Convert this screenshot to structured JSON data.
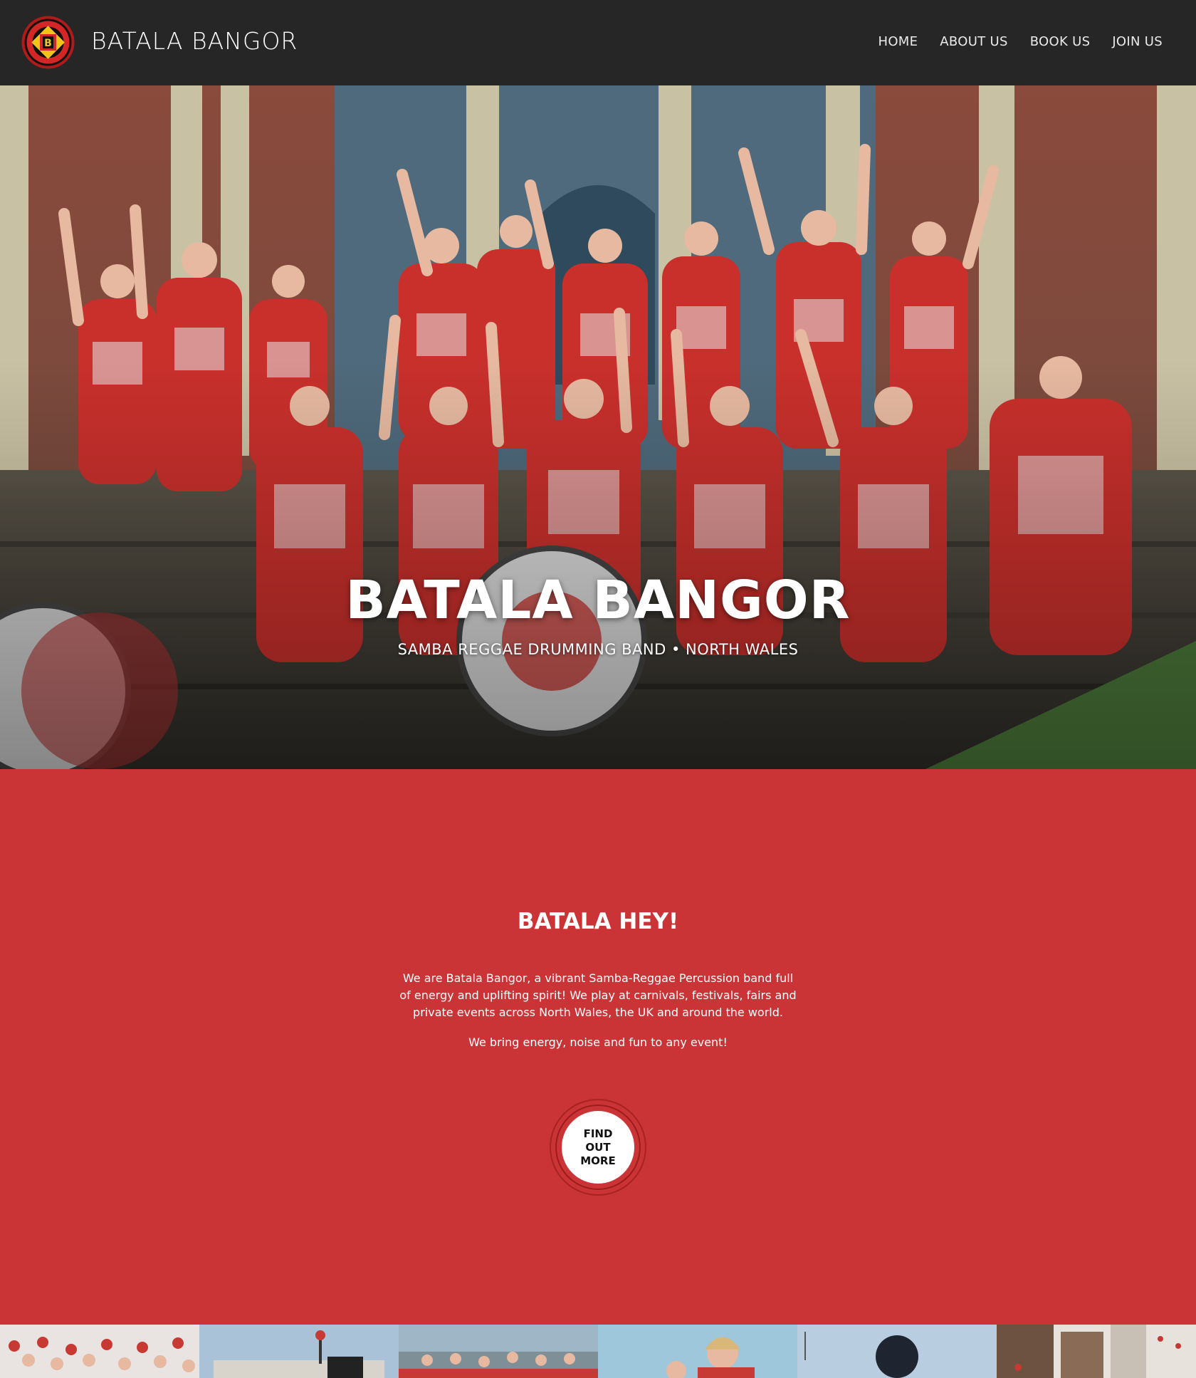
{
  "header": {
    "brand": "BATALA BANGOR",
    "logo_icon": "batala-drum-badge-icon",
    "nav": [
      {
        "label": "HOME"
      },
      {
        "label": "ABOUT US"
      },
      {
        "label": "BOOK US"
      },
      {
        "label": "JOIN US"
      }
    ]
  },
  "hero": {
    "title": "BATALA BANGOR",
    "subtitle": "SAMBA REGGAE DRUMMING BAND • NORTH WALES",
    "image": "group-photo-drummers-in-red-costumes"
  },
  "intro": {
    "heading": "BATALA HEY!",
    "paragraph1": "We are Batala Bangor, a vibrant Samba-Reggae Percussion band full of energy and uplifting spirit! We play at carnivals, festivals, fairs and private events across North Wales, the UK and around the world.",
    "paragraph2": "We bring energy, noise and fun to any event!",
    "cta_label": "FIND OUT MORE"
  },
  "gallery": [
    {
      "image": "crowd-of-drummers-photo"
    },
    {
      "image": "drummer-sky-photo"
    },
    {
      "image": "band-on-beach-photo"
    },
    {
      "image": "smiling-drummer-photo"
    },
    {
      "image": "drummer-silhouette-photo"
    },
    {
      "image": "street-parade-photo"
    }
  ],
  "colors": {
    "header_bg": "#262626",
    "accent_red": "#cb3436",
    "button_bg": "#ffffff"
  }
}
